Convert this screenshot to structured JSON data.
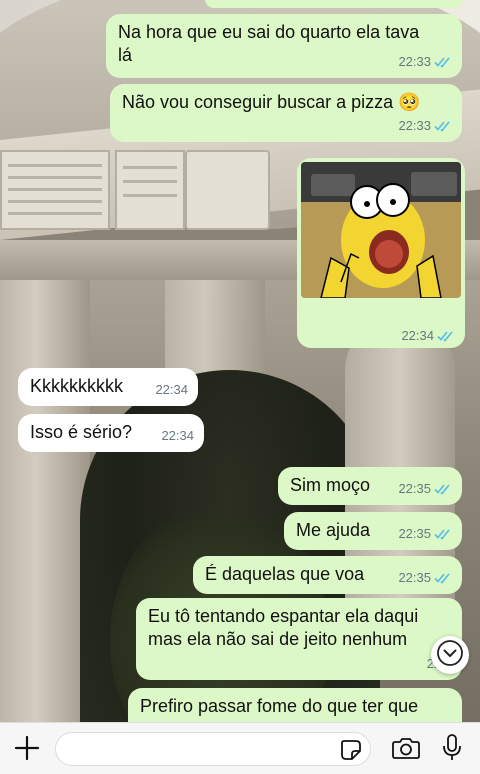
{
  "messages": [
    {
      "direction": "out",
      "text": "Na hora que eu sai do quarto ela tava\nlá",
      "time": "22:33",
      "status": "read"
    },
    {
      "direction": "out",
      "text": "Não vou conseguir buscar a pizza 🥺",
      "time": "22:33",
      "status": "read"
    },
    {
      "direction": "out",
      "type": "image",
      "image_desc": "homer-scared-meme",
      "time": "22:34",
      "status": "read"
    },
    {
      "direction": "in",
      "text": "Kkkkkkkkkk",
      "time": "22:34"
    },
    {
      "direction": "in",
      "text": "Isso é sério?",
      "time": "22:34"
    },
    {
      "direction": "out",
      "text": "Sim moço",
      "time": "22:35",
      "status": "read"
    },
    {
      "direction": "out",
      "text": "Me ajuda",
      "time": "22:35",
      "status": "read"
    },
    {
      "direction": "out",
      "text": "É daquelas que voa",
      "time": "22:35",
      "status": "read"
    },
    {
      "direction": "out",
      "text": "Eu tô tentando espantar ela daqui\nmas ela não sai de jeito nenhum",
      "time": "22:3",
      "status": "read"
    },
    {
      "direction": "out",
      "text": "Prefiro passar fome do que ter que",
      "time": "",
      "status": ""
    }
  ],
  "input": {
    "placeholder": "",
    "value": ""
  },
  "icons": {
    "plus": "plus-icon",
    "sticker": "sticker-icon",
    "camera": "camera-icon",
    "mic": "microphone-icon",
    "scroll": "chevron-down-icon",
    "ticks": "double-check-icon"
  },
  "colors": {
    "outgoing": "#dcf8c6",
    "incoming": "#ffffff",
    "read_ticks": "#53bdeb",
    "meta": "#667781"
  }
}
